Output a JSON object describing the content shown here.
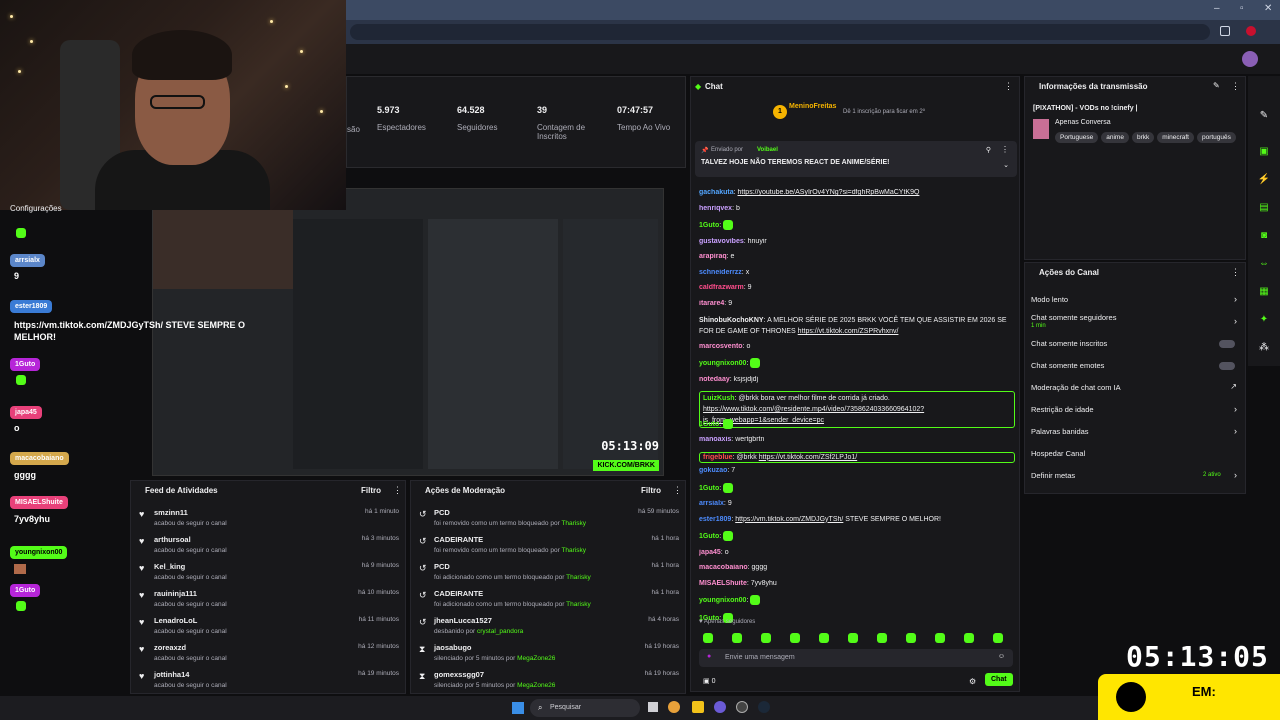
{
  "stats": [
    {
      "value": "5.973",
      "label": "Espectadores"
    },
    {
      "value": "64.528",
      "label": "Seguidores"
    },
    {
      "value": "39",
      "label": "Contagem de Inscritos"
    },
    {
      "value": "07:47:57",
      "label": "Tempo Ao Vivo"
    }
  ],
  "stats_cut_label": "são",
  "overlay_left": {
    "config_label": "Configurações",
    "messages": [
      {
        "name": "arrsialx",
        "color": "#5b86c9",
        "text": "9"
      },
      {
        "name": "ester1809",
        "color": "#3a7bd5",
        "text": "https://vm.tiktok.com/ZMDJGyTSh/ STEVE SEMPRE O MELHOR!"
      },
      {
        "name": "1Guto",
        "color": "#b625d8",
        "text": ""
      },
      {
        "name": "japa45",
        "color": "#e8417a",
        "text": "o"
      },
      {
        "name": "macacobaiano",
        "color": "#d4a84c",
        "text": "gggg"
      },
      {
        "name": "MISAELShuite",
        "color": "#e8417a",
        "text": "7yv8yhu"
      },
      {
        "name": "youngnixon00",
        "color": "#53fc18",
        "text": ""
      },
      {
        "name": "1Guto",
        "color": "#b625d8",
        "text": ""
      }
    ]
  },
  "preview": {
    "timer": "05:13:09",
    "kick": "KICK.COM/BRKK"
  },
  "feed": {
    "title": "Feed de Atividades",
    "filter": "Filtro",
    "items": [
      {
        "name": "smzinn11",
        "desc": "acabou de seguir o canal",
        "time": "há 1 minuto"
      },
      {
        "name": "arthursoal",
        "desc": "acabou de seguir o canal",
        "time": "há 3 minutos"
      },
      {
        "name": "Kel_king",
        "desc": "acabou de seguir o canal",
        "time": "há 9 minutos"
      },
      {
        "name": "rauininja111",
        "desc": "acabou de seguir o canal",
        "time": "há 10 minutos"
      },
      {
        "name": "LenadroLoL",
        "desc": "acabou de seguir o canal",
        "time": "há 11 minutos"
      },
      {
        "name": "zoreaxzd",
        "desc": "acabou de seguir o canal",
        "time": "há 12 minutos"
      },
      {
        "name": "jottinha14",
        "desc": "acabou de seguir o canal",
        "time": "há 19 minutos"
      }
    ]
  },
  "moderation": {
    "title": "Ações de Moderação",
    "filter": "Filtro",
    "items": [
      {
        "name": "PCD",
        "desc": "foi removido como um termo bloqueado por",
        "by": "Tharisky",
        "time": "há 59 minutos"
      },
      {
        "name": "CADEIRANTE",
        "desc": "foi removido como um termo bloqueado por",
        "by": "Tharisky",
        "time": "há 1 hora"
      },
      {
        "name": "PCD",
        "desc": "foi adicionado como um termo bloqueado por",
        "by": "Tharisky",
        "time": "há 1 hora"
      },
      {
        "name": "CADEIRANTE",
        "desc": "foi adicionado como um termo bloqueado por",
        "by": "Tharisky",
        "time": "há 1 hora"
      },
      {
        "name": "jheanLucca1527",
        "desc": "desbanido por",
        "by": "crystal_pandora",
        "time": "há 4 horas"
      },
      {
        "name": "jaosabugo",
        "desc": "silenciado por 5 minutos por",
        "by": "MegaZone26",
        "time": "há 19 horas"
      },
      {
        "name": "gomexssgg07",
        "desc": "silenciado por 5 minutos por",
        "by": "MegaZone26",
        "time": "há 19 horas"
      }
    ]
  },
  "chat": {
    "title": "Chat",
    "top_user": "MeninoFreitas",
    "top_badge": "1",
    "top_note": "Dê 1 inscrição para ficar em 2º",
    "pinned_by_label": "Enviado por",
    "pinned_user": "Voibael",
    "pinned_text": "TALVEZ HOJE NÃO TEREMOS REACT DE ANIME/SÉRIE!",
    "lines": [
      {
        "user": "gachakuta",
        "color": "#53a6ff",
        "text": "",
        "link": "https://youtube.be/ASyIrOv4YNg?si=dfghRpBwMaCYtK9Q"
      },
      {
        "user": "henriqvex",
        "color": "#c9a0ff",
        "text": "b"
      },
      {
        "user": "1Guto",
        "color": "#53fc18",
        "text": "",
        "emote": true
      },
      {
        "user": "gustavovibes",
        "color": "#c9a0ff",
        "text": "hnuyir"
      },
      {
        "user": "arapiraq",
        "color": "#ff8fd0",
        "text": "e"
      },
      {
        "user": "schneiderrzz",
        "color": "#4d8cff",
        "text": "x"
      },
      {
        "user": "caldfrazwarm",
        "color": "#ff4d8c",
        "text": "9"
      },
      {
        "user": "itarare4",
        "color": "#ff8fd0",
        "text": "9"
      },
      {
        "user": "ShinobuKochoKNY",
        "color": "#efeff1",
        "text": "A MELHOR SÉRIE DE 2025 BRKK VOCÊ TEM QUE ASSISTIR EM 2026 SE FOR DE GAME OF THRONES",
        "link": "https://vt.tiktok.com/ZSPRvhxnv/"
      },
      {
        "user": "marcosvento",
        "color": "#ff8fd0",
        "text": "o"
      },
      {
        "user": "youngnixon00",
        "color": "#53fc18",
        "text": "",
        "emote": true
      },
      {
        "user": "notedaay",
        "color": "#ff8fd0",
        "text": "ksjsjdjdj"
      },
      {
        "user": "LuizKush",
        "color": "#53fc18",
        "text": "@brkk bora ver melhor filme de corrida já criado.",
        "link": "https://www.tiktok.com/@residente.mp4/video/7358624033660964102?is_from_webapp=1&sender_device=pc"
      },
      {
        "user": "1Guto",
        "color": "#53fc18",
        "text": "",
        "emote": true
      },
      {
        "user": "manoaxis",
        "color": "#c9a0ff",
        "text": "wertgbrtn"
      },
      {
        "user": "frigeblue",
        "color": "#ff4d4d",
        "text": "@brkk",
        "link": "https://vt.tiktok.com/ZSf2LPJo1/"
      },
      {
        "user": "gokuzao",
        "color": "#4d8cff",
        "text": "7"
      },
      {
        "user": "1Guto",
        "color": "#53fc18",
        "text": "",
        "emote": true
      },
      {
        "user": "arrsialx",
        "color": "#4d8cff",
        "text": "9"
      },
      {
        "user": "ester1809",
        "color": "#4d8cff",
        "text": "STEVE SEMPRE O MELHOR!",
        "link": "https://vm.tiktok.com/ZMDJGyTSh/"
      },
      {
        "user": "1Guto",
        "color": "#53fc18",
        "text": "",
        "emote": true
      },
      {
        "user": "japa45",
        "color": "#ff8fd0",
        "text": "o"
      },
      {
        "user": "macacobaiano",
        "color": "#ff8fd0",
        "text": "gggg"
      },
      {
        "user": "MISAELShuite",
        "color": "#ff8fd0",
        "text": "7yv8yhu"
      },
      {
        "user": "youngnixon00",
        "color": "#53fc18",
        "text": "",
        "emote": true
      },
      {
        "user": "1Guto",
        "color": "#53fc18",
        "text": "",
        "emote": true
      }
    ],
    "followers_only": "Apenas seguidores",
    "input_placeholder": "Envie uma mensagem",
    "count": "0",
    "send_label": "Chat"
  },
  "info": {
    "title": "Informações da transmissão",
    "stream_title": "[PIXATHON] - VODs no !cinefy |",
    "category": "Apenas Conversa",
    "tags": [
      "Portuguese",
      "anime",
      "brkk",
      "minecraft",
      "português"
    ]
  },
  "actions": {
    "title": "Ações do Canal",
    "rows": [
      {
        "label": "Modo lento",
        "type": "chevron"
      },
      {
        "label": "Chat somente seguidores",
        "sub": "1 min",
        "type": "chevron"
      },
      {
        "label": "Chat somente inscritos",
        "type": "toggle"
      },
      {
        "label": "Chat somente emotes",
        "type": "toggle"
      },
      {
        "label": "Moderação de chat com IA",
        "type": "link"
      },
      {
        "label": "Restrição de idade",
        "type": "chevron"
      },
      {
        "label": "Palavras banidas",
        "type": "chevron"
      },
      {
        "label": "Hospedar Canal",
        "type": "none"
      },
      {
        "label": "Definir metas",
        "sub_right": "2 ativo",
        "type": "chevron"
      }
    ]
  },
  "overlay": {
    "big_timer": "05:13:05",
    "em_label": "EM:"
  },
  "taskbar": {
    "search": "Pesquisar"
  },
  "colors": {
    "accent": "#53fc18",
    "panel": "#18181b",
    "bg": "#0e0e10"
  }
}
